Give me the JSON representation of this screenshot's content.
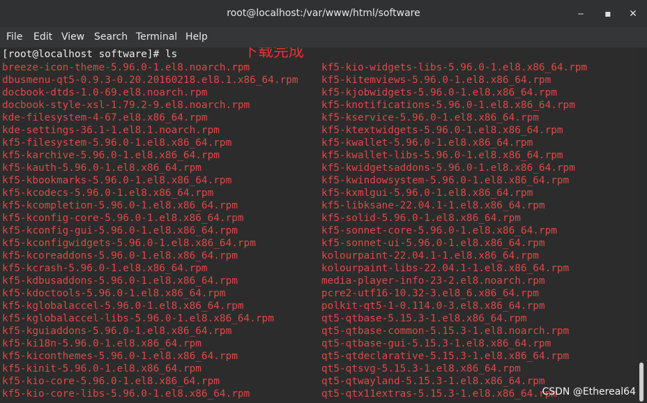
{
  "window": {
    "title": "root@localhost:/var/www/html/software",
    "minimize_glyph": "‒",
    "maximize_glyph": "▪",
    "close_glyph": "✕"
  },
  "menu": {
    "items": [
      "File",
      "Edit",
      "View",
      "Search",
      "Terminal",
      "Help"
    ]
  },
  "terminal": {
    "prompt_line": "[root@localhost software]# ls",
    "annotation": "下载完成",
    "left_files": [
      "breeze-icon-theme-5.96.0-1.el8.noarch.rpm",
      "dbusmenu-qt5-0.9.3-0.20.20160218.el8.1.x86_64.rpm",
      "docbook-dtds-1.0-69.el8.noarch.rpm",
      "docbook-style-xsl-1.79.2-9.el8.noarch.rpm",
      "kde-filesystem-4-67.el8.x86_64.rpm",
      "kde-settings-36.1-1.el8.1.noarch.rpm",
      "kf5-filesystem-5.96.0-1.el8.x86_64.rpm",
      "kf5-karchive-5.96.0-1.el8.x86_64.rpm",
      "kf5-kauth-5.96.0-1.el8.x86_64.rpm",
      "kf5-kbookmarks-5.96.0-1.el8.x86_64.rpm",
      "kf5-kcodecs-5.96.0-1.el8.x86_64.rpm",
      "kf5-kcompletion-5.96.0-1.el8.x86_64.rpm",
      "kf5-kconfig-core-5.96.0-1.el8.x86_64.rpm",
      "kf5-kconfig-gui-5.96.0-1.el8.x86_64.rpm",
      "kf5-kconfigwidgets-5.96.0-1.el8.x86_64.rpm",
      "kf5-kcoreaddons-5.96.0-1.el8.x86_64.rpm",
      "kf5-kcrash-5.96.0-1.el8.x86_64.rpm",
      "kf5-kdbusaddons-5.96.0-1.el8.x86_64.rpm",
      "kf5-kdoctools-5.96.0-1.el8.x86_64.rpm",
      "kf5-kglobalaccel-5.96.0-1.el8.x86_64.rpm",
      "kf5-kglobalaccel-libs-5.96.0-1.el8.x86_64.rpm",
      "kf5-kguiaddons-5.96.0-1.el8.x86_64.rpm",
      "kf5-ki18n-5.96.0-1.el8.x86_64.rpm",
      "kf5-kiconthemes-5.96.0-1.el8.x86_64.rpm",
      "kf5-kinit-5.96.0-1.el8.x86_64.rpm",
      "kf5-kio-core-5.96.0-1.el8.x86_64.rpm",
      "kf5-kio-core-libs-5.96.0-1.el8.x86_64.rpm"
    ],
    "right_files": [
      "kf5-kio-widgets-libs-5.96.0-1.el8.x86_64.rpm",
      "kf5-kitemviews-5.96.0-1.el8.x86_64.rpm",
      "kf5-kjobwidgets-5.96.0-1.el8.x86_64.rpm",
      "kf5-knotifications-5.96.0-1.el8.x86_64.rpm",
      "kf5-kservice-5.96.0-1.el8.x86_64.rpm",
      "kf5-ktextwidgets-5.96.0-1.el8.x86_64.rpm",
      "kf5-kwallet-5.96.0-1.el8.x86_64.rpm",
      "kf5-kwallet-libs-5.96.0-1.el8.x86_64.rpm",
      "kf5-kwidgetsaddons-5.96.0-1.el8.x86_64.rpm",
      "kf5-kwindowsystem-5.96.0-1.el8.x86_64.rpm",
      "kf5-kxmlgui-5.96.0-1.el8.x86_64.rpm",
      "kf5-libksane-22.04.1-1.el8.x86_64.rpm",
      "kf5-solid-5.96.0-1.el8.x86_64.rpm",
      "kf5-sonnet-core-5.96.0-1.el8.x86_64.rpm",
      "kf5-sonnet-ui-5.96.0-1.el8.x86_64.rpm",
      "kolourpaint-22.04.1-1.el8.x86_64.rpm",
      "kolourpaint-libs-22.04.1-1.el8.x86_64.rpm",
      "media-player-info-23-2.el8.noarch.rpm",
      "pcre2-utf16-10.32-3.el8_6.x86_64.rpm",
      "polkit-qt5-1-0.114.0-3.el8.x86_64.rpm",
      "qt5-qtbase-5.15.3-1.el8.x86_64.rpm",
      "qt5-qtbase-common-5.15.3-1.el8.noarch.rpm",
      "qt5-qtbase-gui-5.15.3-1.el8.x86_64.rpm",
      "qt5-qtdeclarative-5.15.3-1.el8.x86_64.rpm",
      "qt5-qtsvg-5.15.3-1.el8.x86_64.rpm",
      "qt5-qtwayland-5.15.3-1.el8.x86_64.rpm",
      "qt5-qtx11extras-5.15.3-1.el8.x86_64.rpm"
    ]
  },
  "watermark": "CSDN @Ethereal64",
  "colors": {
    "file_text": "#e04848",
    "annotation": "#e8322b",
    "background": "#2c2c2c"
  }
}
